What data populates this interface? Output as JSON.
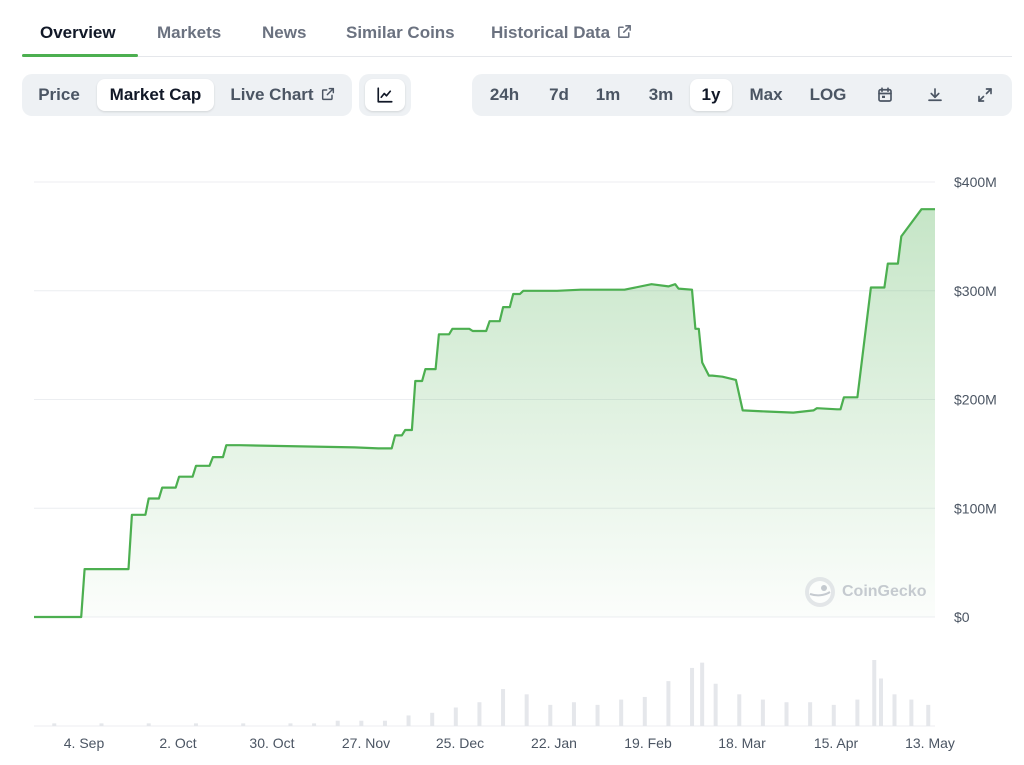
{
  "tabs": [
    {
      "label": "Overview"
    },
    {
      "label": "Markets"
    },
    {
      "label": "News"
    },
    {
      "label": "Similar Coins"
    },
    {
      "label": "Historical Data"
    }
  ],
  "metric_tabs": [
    {
      "label": "Price"
    },
    {
      "label": "Market Cap"
    },
    {
      "label": "Live Chart"
    }
  ],
  "range_tabs": [
    {
      "label": "24h"
    },
    {
      "label": "7d"
    },
    {
      "label": "1m"
    },
    {
      "label": "3m"
    },
    {
      "label": "1y"
    },
    {
      "label": "Max"
    },
    {
      "label": "LOG"
    }
  ],
  "active_tab": "Overview",
  "active_metric": "Market Cap",
  "active_range": "1y",
  "watermark": "CoinGecko",
  "colors": {
    "line": "#4caf50",
    "accent": "#4caf50",
    "volume": "#e5e7eb"
  },
  "icons": [
    "external-link-icon",
    "line-chart-icon",
    "calendar-icon",
    "download-icon",
    "expand-icon",
    "coingecko-logo-icon"
  ],
  "chart_data": {
    "type": "area",
    "title": "",
    "xlabel": "",
    "ylabel": "",
    "ylim": [
      0,
      400
    ],
    "y_unit": "M",
    "yticks": [
      {
        "value": 0,
        "label": "$0"
      },
      {
        "value": 100,
        "label": "$100M"
      },
      {
        "value": 200,
        "label": "$200M"
      },
      {
        "value": 300,
        "label": "$300M"
      },
      {
        "value": 400,
        "label": "$400M"
      }
    ],
    "xticks": [
      "4. Sep",
      "2. Oct",
      "30. Oct",
      "27. Nov",
      "25. Dec",
      "22. Jan",
      "19. Feb",
      "18. Mar",
      "15. Apr",
      "13. May"
    ],
    "grid": true,
    "series": [
      {
        "x": [
          "2023-08-21",
          "2023-09-04",
          "2023-09-05",
          "2023-09-18",
          "2023-09-19",
          "2023-09-23",
          "2023-09-24",
          "2023-09-27",
          "2023-09-28",
          "2023-10-02",
          "2023-10-03",
          "2023-10-07",
          "2023-10-08",
          "2023-10-12",
          "2023-10-13",
          "2023-10-16",
          "2023-10-17",
          "2023-10-20",
          "2023-10-21",
          "2023-11-24",
          "2023-12-01",
          "2023-12-05",
          "2023-12-06",
          "2023-12-08",
          "2023-12-09",
          "2023-12-11",
          "2023-12-12",
          "2023-12-14",
          "2023-12-15",
          "2023-12-18",
          "2023-12-19",
          "2023-12-22",
          "2023-12-23",
          "2023-12-28",
          "2023-12-29",
          "2024-01-02",
          "2024-01-03",
          "2024-01-06",
          "2024-01-07",
          "2024-01-09",
          "2024-01-10",
          "2024-01-12",
          "2024-01-13",
          "2024-01-23",
          "2024-01-30",
          "2024-02-08",
          "2024-02-12",
          "2024-02-20",
          "2024-02-25",
          "2024-02-27",
          "2024-02-28",
          "2024-03-03",
          "2024-03-04",
          "2024-03-05",
          "2024-03-06",
          "2024-03-08",
          "2024-03-09",
          "2024-03-12",
          "2024-03-16",
          "2024-03-18",
          "2024-03-25",
          "2024-04-02",
          "2024-04-08",
          "2024-04-09",
          "2024-04-15",
          "2024-04-16",
          "2024-04-17",
          "2024-04-20",
          "2024-04-21",
          "2024-04-25",
          "2024-04-26",
          "2024-04-29",
          "2024-04-30",
          "2024-05-03",
          "2024-05-04",
          "2024-05-10",
          "2024-05-14"
        ],
        "values": [
          0,
          0,
          44,
          44,
          94,
          94,
          109,
          109,
          119,
          119,
          129,
          129,
          139,
          139,
          147,
          147,
          158,
          158,
          158,
          156,
          155,
          155,
          167,
          167,
          172,
          172,
          217,
          217,
          228,
          228,
          260,
          260,
          265,
          265,
          263,
          263,
          272,
          272,
          285,
          285,
          297,
          297,
          300,
          300,
          301,
          301,
          301,
          306,
          304,
          306,
          302,
          301,
          265,
          265,
          234,
          222,
          222,
          221,
          218,
          190,
          189,
          188,
          190,
          192,
          191,
          191,
          202,
          202,
          202,
          303,
          303,
          303,
          325,
          325,
          350,
          375,
          375
        ]
      }
    ],
    "volume": [
      {
        "x": "2023-08-27",
        "value": 1
      },
      {
        "x": "2023-09-10",
        "value": 1
      },
      {
        "x": "2023-09-24",
        "value": 1
      },
      {
        "x": "2023-10-08",
        "value": 1
      },
      {
        "x": "2023-10-22",
        "value": 1
      },
      {
        "x": "2023-11-05",
        "value": 1
      },
      {
        "x": "2023-11-12",
        "value": 1
      },
      {
        "x": "2023-11-19",
        "value": 2
      },
      {
        "x": "2023-11-26",
        "value": 2
      },
      {
        "x": "2023-12-03",
        "value": 2
      },
      {
        "x": "2023-12-10",
        "value": 4
      },
      {
        "x": "2023-12-17",
        "value": 5
      },
      {
        "x": "2023-12-24",
        "value": 7
      },
      {
        "x": "2023-12-31",
        "value": 9
      },
      {
        "x": "2024-01-07",
        "value": 14
      },
      {
        "x": "2024-01-14",
        "value": 12
      },
      {
        "x": "2024-01-21",
        "value": 8
      },
      {
        "x": "2024-01-28",
        "value": 9
      },
      {
        "x": "2024-02-04",
        "value": 8
      },
      {
        "x": "2024-02-11",
        "value": 10
      },
      {
        "x": "2024-02-18",
        "value": 11
      },
      {
        "x": "2024-02-25",
        "value": 17
      },
      {
        "x": "2024-03-03",
        "value": 22
      },
      {
        "x": "2024-03-06",
        "value": 24
      },
      {
        "x": "2024-03-10",
        "value": 16
      },
      {
        "x": "2024-03-17",
        "value": 12
      },
      {
        "x": "2024-03-24",
        "value": 10
      },
      {
        "x": "2024-03-31",
        "value": 9
      },
      {
        "x": "2024-04-07",
        "value": 9
      },
      {
        "x": "2024-04-14",
        "value": 8
      },
      {
        "x": "2024-04-21",
        "value": 10
      },
      {
        "x": "2024-04-26",
        "value": 25
      },
      {
        "x": "2024-04-28",
        "value": 18
      },
      {
        "x": "2024-05-02",
        "value": 12
      },
      {
        "x": "2024-05-07",
        "value": 10
      },
      {
        "x": "2024-05-12",
        "value": 8
      }
    ]
  }
}
